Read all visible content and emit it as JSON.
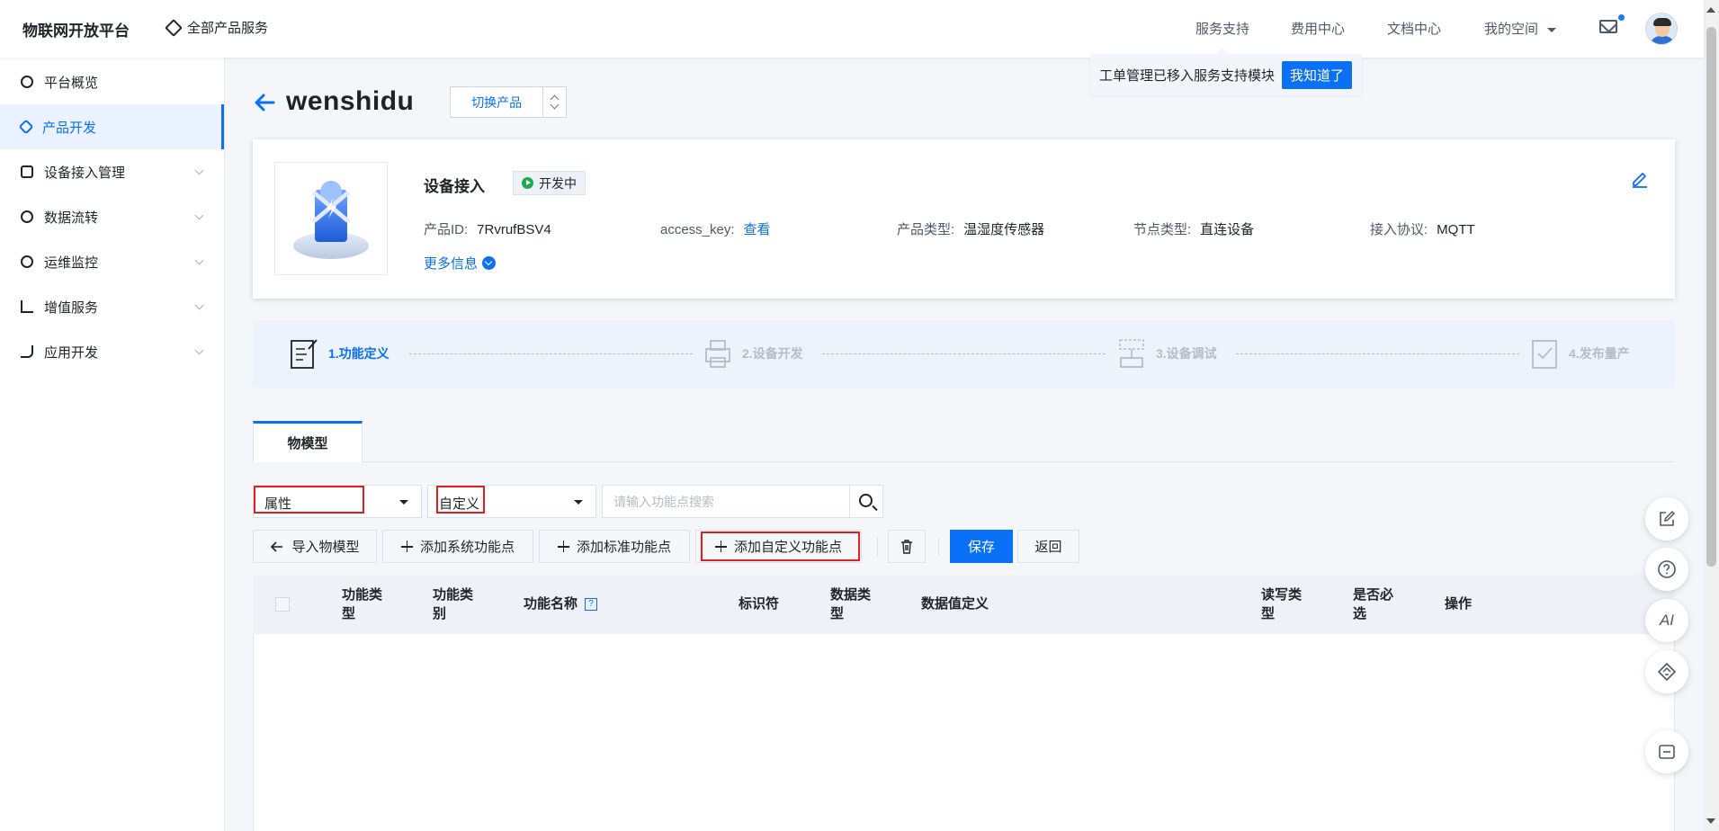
{
  "header": {
    "brand": "物联网开放平台",
    "all_services": "全部产品服务",
    "nav": [
      "服务支持",
      "费用中心",
      "文档中心",
      "我的空间"
    ]
  },
  "tooltip": {
    "text": "工单管理已移入服务支持模块",
    "button": "我知道了"
  },
  "sidebar": {
    "items": [
      {
        "label": "平台概览",
        "icon": "overview-icon"
      },
      {
        "label": "产品开发",
        "icon": "cube-icon",
        "active": true
      },
      {
        "label": "设备接入管理",
        "icon": "device-access-icon"
      },
      {
        "label": "数据流转",
        "icon": "data-flow-icon"
      },
      {
        "label": "运维监控",
        "icon": "monitor-icon"
      },
      {
        "label": "增值服务",
        "icon": "value-added-icon"
      },
      {
        "label": "应用开发",
        "icon": "app-dev-icon"
      }
    ]
  },
  "product": {
    "name": "wenshidu",
    "switch_label": "切换产品",
    "card_title": "设备接入",
    "status": "开发中",
    "id_label": "产品ID:",
    "id_value": "7RvrufBSV4",
    "access_key_label": "access_key:",
    "access_key_link": "查看",
    "type_label": "产品类型:",
    "type_value": "温湿度传感器",
    "node_label": "节点类型:",
    "node_value": "直连设备",
    "protocol_label": "接入协议:",
    "protocol_value": "MQTT",
    "more_info": "更多信息"
  },
  "steps": [
    "1.功能定义",
    "2.设备开发",
    "3.设备调试",
    "4.发布量产"
  ],
  "tabs": [
    "物模型"
  ],
  "filters": {
    "category": "属性",
    "source": "自定义",
    "search_placeholder": "请输入功能点搜索"
  },
  "actions": {
    "import": "导入物模型",
    "add_system": "添加系统功能点",
    "add_standard": "添加标准功能点",
    "add_custom": "添加自定义功能点",
    "save": "保存",
    "back": "返回"
  },
  "table": {
    "columns": [
      "功能类型",
      "功能类别",
      "功能名称",
      "标识符",
      "数据类型",
      "数据值定义",
      "读写类型",
      "是否必选",
      "操作"
    ]
  },
  "colors": {
    "accent": "#0a70f5",
    "status_green": "#1fa950",
    "highlight_red": "#e02020"
  }
}
